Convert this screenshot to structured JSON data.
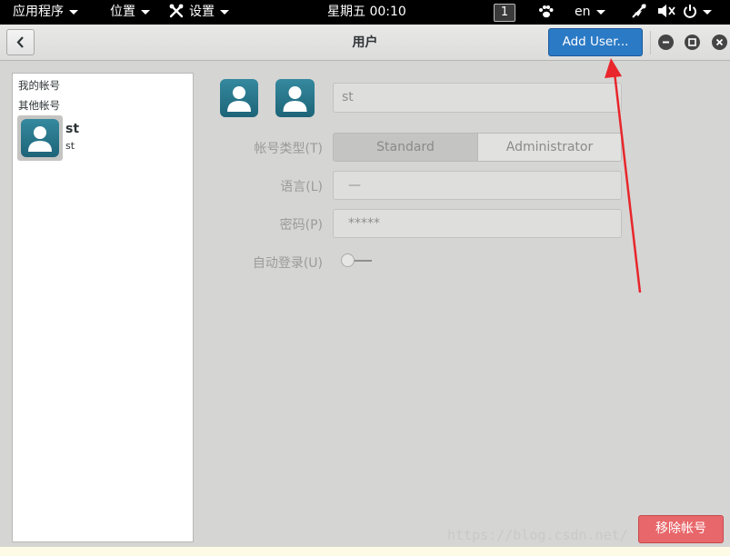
{
  "top_bar": {
    "applications_menu": "应用程序",
    "places_menu": "位置",
    "settings_menu": "设置",
    "clock": "星期五 00:10",
    "workspace": "1",
    "input_language": "en"
  },
  "header": {
    "title": "用户",
    "add_user_label": "Add User..."
  },
  "sidebar": {
    "my_account_label": "我的帐号",
    "other_accounts_label": "其他帐号",
    "users": [
      {
        "name": "st",
        "subtitle": "st"
      }
    ]
  },
  "details": {
    "full_name_value": "st",
    "account_type_label": "帐号类型(T)",
    "account_type_options": [
      "Standard",
      "Administrator"
    ],
    "account_type_selected": "Standard",
    "language_label": "语言(L)",
    "language_value": "—",
    "password_label": "密码(P)",
    "password_value": "*****",
    "auto_login_label": "自动登录(U)",
    "auto_login_enabled": false
  },
  "footer": {
    "remove_account_label": "移除帐号"
  },
  "watermark": "https://blog.csdn.net/",
  "colors": {
    "accent": "#2b7ac5",
    "destructive": "#e8676a",
    "avatar": "#1f6f83",
    "annotation_arrow": "#e8262b"
  }
}
